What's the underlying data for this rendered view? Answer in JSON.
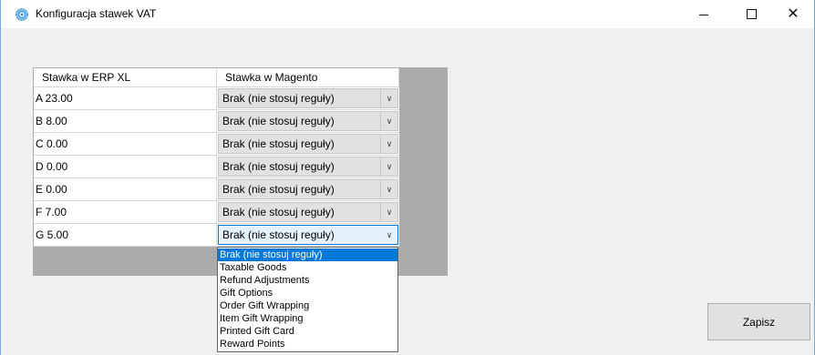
{
  "window": {
    "title": "Konfiguracja stawek VAT",
    "icon": "gear-icon",
    "controls": {
      "minimize": "minimize-icon",
      "maximize": "maximize-icon",
      "close": "close-icon"
    }
  },
  "grid": {
    "columns": [
      "Stawka w ERP XL",
      "Stawka w Magento"
    ],
    "rows": [
      {
        "erp": "A 23.00",
        "magento": "Brak (nie stosuj reguły)"
      },
      {
        "erp": "B 8.00",
        "magento": "Brak (nie stosuj reguły)"
      },
      {
        "erp": "C 0.00",
        "magento": "Brak (nie stosuj reguły)"
      },
      {
        "erp": "D 0.00",
        "magento": "Brak (nie stosuj reguły)"
      },
      {
        "erp": "E 0.00",
        "magento": "Brak (nie stosuj reguły)"
      },
      {
        "erp": "F 7.00",
        "magento": "Brak (nie stosuj reguły)"
      },
      {
        "erp": "G 5.00",
        "magento": "Brak (nie stosuj reguły)"
      }
    ],
    "active_row": 6
  },
  "dropdown": {
    "options": [
      "Brak (nie stosuj reguły)",
      "Taxable Goods",
      "Refund Adjustments",
      "Gift Options",
      "Order Gift Wrapping",
      "Item Gift Wrapping",
      "Printed Gift Card",
      "Reward Points"
    ],
    "selected_index": 0
  },
  "buttons": {
    "save": "Zapisz"
  },
  "colors": {
    "accent": "#0078d7",
    "grid_bg": "#ababab",
    "window_bg": "#f0f0f0"
  }
}
